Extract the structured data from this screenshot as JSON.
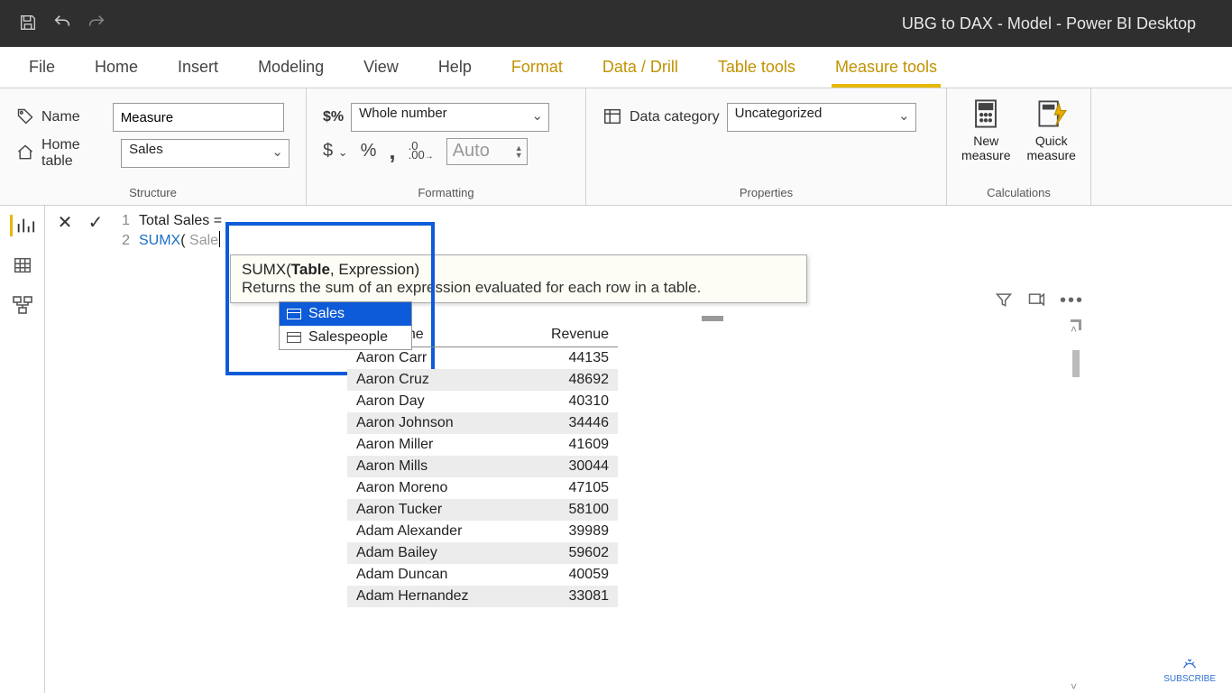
{
  "titlebar": {
    "title": "UBG to DAX - Model - Power BI Desktop"
  },
  "tabs": [
    "File",
    "Home",
    "Insert",
    "Modeling",
    "View",
    "Help"
  ],
  "context_tabs": [
    "Format",
    "Data / Drill",
    "Table tools",
    "Measure tools"
  ],
  "active_tab": "Measure tools",
  "ribbon": {
    "structure": {
      "label": "Structure",
      "name_label": "Name",
      "name_value": "Measure",
      "hometable_label": "Home table",
      "hometable_value": "Sales"
    },
    "formatting": {
      "label": "Formatting",
      "format_value": "Whole number",
      "auto_label": "Auto",
      "symbols": {
        "dollar": "$",
        "dropdown": "⌄",
        "percent": "%",
        "comma": ",",
        "decimals": ".00"
      }
    },
    "properties": {
      "label": "Properties",
      "datacat_label": "Data category",
      "datacat_value": "Uncategorized"
    },
    "calculations": {
      "label": "Calculations",
      "new_measure": "New\nmeasure",
      "quick_measure": "Quick\nmeasure"
    }
  },
  "formula": {
    "line1": "Total Sales =",
    "line2_func": "SUMX",
    "line2_paren": "(",
    "line2_typed": "Sale"
  },
  "tooltip": {
    "sig_pre": "SUMX(",
    "sig_bold": "Table",
    "sig_post": ", Expression)",
    "desc": "Returns the sum of an expression evaluated for each row in a table."
  },
  "suggest": {
    "options": [
      "Sales",
      "Salespeople"
    ],
    "selected_index": 0
  },
  "table": {
    "headers": {
      "name": "mer Name",
      "revenue": "Revenue"
    },
    "rows": [
      {
        "name": "Aaron Carr",
        "rev": 44135
      },
      {
        "name": "Aaron Cruz",
        "rev": 48692
      },
      {
        "name": "Aaron Day",
        "rev": 40310
      },
      {
        "name": "Aaron Johnson",
        "rev": 34446
      },
      {
        "name": "Aaron Miller",
        "rev": 41609
      },
      {
        "name": "Aaron Mills",
        "rev": 30044
      },
      {
        "name": "Aaron Moreno",
        "rev": 47105
      },
      {
        "name": "Aaron Tucker",
        "rev": 58100
      },
      {
        "name": "Adam Alexander",
        "rev": 39989
      },
      {
        "name": "Adam Bailey",
        "rev": 59602
      },
      {
        "name": "Adam Duncan",
        "rev": 40059
      },
      {
        "name": "Adam Hernandez",
        "rev": 33081
      }
    ]
  },
  "subscribe_label": "SUBSCRIBE"
}
